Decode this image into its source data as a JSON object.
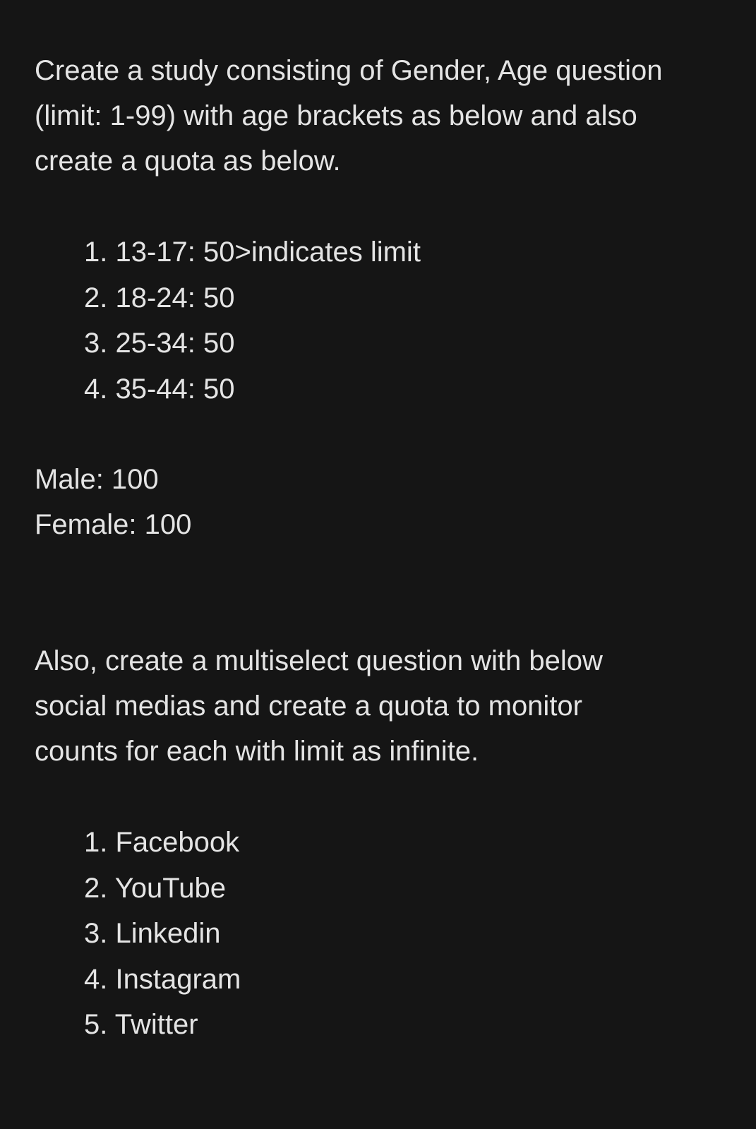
{
  "intro": {
    "lines": [
      "Create a study consisting of Gender, Age question",
      "(limit: 1-99) with age brackets as below and also",
      "create a quota as below."
    ]
  },
  "age_brackets": [
    "1. 13-17: 50>indicates limit",
    "2. 18-24: 50",
    "3. 25-34: 50",
    "4. 35-44: 50"
  ],
  "gender_quota": [
    "Male: 100",
    "Female: 100"
  ],
  "social": {
    "lines": [
      "Also, create a multiselect question with below",
      "social medias and create a quota to monitor",
      "counts for each with limit as infinite."
    ]
  },
  "social_medias": [
    "1. Facebook",
    "2. YouTube",
    "3. Linkedin",
    "4. Instagram",
    "5. Twitter"
  ],
  "colors": {
    "background": "#151515",
    "text": "#e4e4e4"
  }
}
